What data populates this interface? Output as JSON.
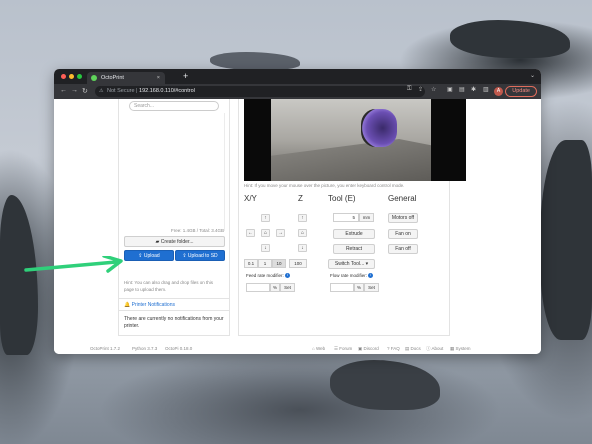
{
  "browser": {
    "tab_title": "OctoPrint",
    "tab_close": "×",
    "new_tab": "+",
    "url_prefix": "Not Secure",
    "url_sep": "|",
    "url": "192.168.0.110/#control",
    "avatar_initial": "A",
    "update_label": "Update"
  },
  "files": {
    "search_placeholder": "Search...",
    "free_total": "Free: 1.4GB / Total: 3.4GB",
    "create_folder": "Create folder...",
    "upload": "Upload",
    "upload_sd": "Upload to SD",
    "hint": "Hint: You can also drag and drop files on this page to upload them."
  },
  "notifications": {
    "title": "Printer Notifications",
    "body": "There are currently no notifications from your printer."
  },
  "control": {
    "video_hint": "Hint: If you move your mouse over the picture, you enter keyboard control mode.",
    "xy_title": "X/Y",
    "z_title": "Z",
    "tool_title": "Tool (E)",
    "general_title": "General",
    "steps": [
      "0.1",
      "1",
      "10",
      "100"
    ],
    "extrude_amount": "5",
    "extrude_unit": "mm",
    "extrude": "Extrude",
    "retract": "Retract",
    "switch_tool": "Switch Tool...",
    "motors_off": "Motors off",
    "fan_on": "Fan on",
    "fan_off": "Fan off",
    "feed_rate_label": "Feed rate modifier:",
    "flow_rate_label": "Flow rate modifier:",
    "percent": "%",
    "set": "Set"
  },
  "footer": {
    "octoprint_version": "OctoPrint 1.7.2",
    "python_version": "Python 3.7.3",
    "octopi_version": "OctoPi 0.18.0",
    "links": [
      "Web",
      "Forum",
      "Discord",
      "FAQ",
      "Docs",
      "About",
      "System"
    ]
  },
  "colors": {
    "primary": "#1f6fd1",
    "arrow": "#2fd07a"
  }
}
